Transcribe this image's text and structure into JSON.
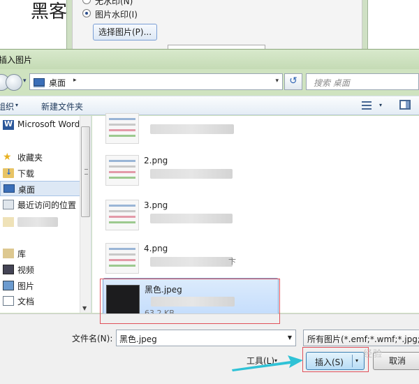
{
  "document": {
    "text": "黑客"
  },
  "watermark_dialog": {
    "no_watermark_label": "无水印(N)",
    "picture_watermark_label": "图片水印(I)",
    "select_picture_button": "选择图片(P)..."
  },
  "dialog": {
    "title": "插入图片",
    "address": {
      "location": "桌面",
      "chevron": "▸",
      "dropdown": "▾"
    },
    "refresh": "↺",
    "search_placeholder": "搜索 桌面",
    "toolbar": {
      "organize": "组织",
      "organize_dd": "▾",
      "new_folder": "新建文件夹",
      "view_dd": "▾"
    },
    "nav": [
      {
        "label": "Microsoft Word",
        "icon": "word-icon"
      },
      {
        "label": "收藏夹",
        "icon": "favorites-star-icon"
      },
      {
        "label": "下载",
        "icon": "downloads-folder-icon"
      },
      {
        "label": "桌面",
        "icon": "desktop-icon",
        "selected": true
      },
      {
        "label": "最近访问的位置",
        "icon": "recent-places-icon"
      },
      {
        "label": "库",
        "icon": "library-icon"
      },
      {
        "label": "视频",
        "icon": "video-icon"
      },
      {
        "label": "图片",
        "icon": "pictures-icon"
      },
      {
        "label": "文档",
        "icon": "documents-icon"
      }
    ],
    "files": [
      {
        "name": "2.png"
      },
      {
        "name": "3.png"
      },
      {
        "name": "4.png"
      },
      {
        "name": "黑色.jpeg",
        "size": "63.2 KB",
        "selected": true
      }
    ],
    "file_4_extra": "卞",
    "bottom": {
      "filename_label": "文件名(N):",
      "filename_value": "黑色.jpeg",
      "filter": "所有图片(*.emf;*.wmf;*.jpg;*.j",
      "tools": "工具(L)",
      "tools_dd": "▾",
      "insert": "插入(S)",
      "insert_dd": "▾",
      "cancel": "取消"
    },
    "logo_text": "经验"
  }
}
